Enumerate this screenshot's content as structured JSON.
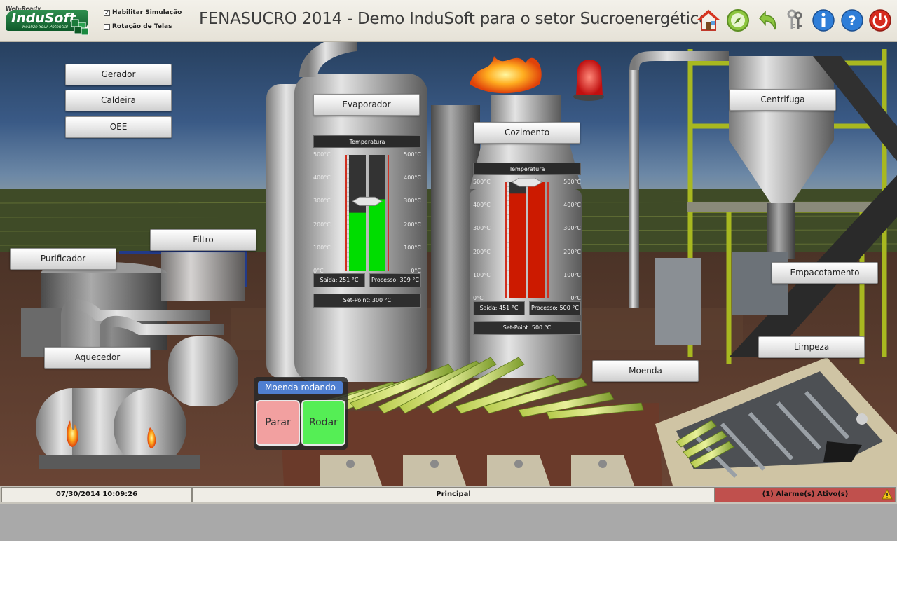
{
  "header": {
    "logo": {
      "small_text": "Web-Ready",
      "main_text": "InduSoft",
      "tagline": "Realize Your Potential"
    },
    "checkboxes": [
      {
        "label": "Habilitar Simulação",
        "checked": true
      },
      {
        "label": "Rotação de Telas",
        "checked": false
      }
    ],
    "title": "FENASUCRO 2014 - Demo InduSoft para o setor Sucroenergético",
    "toolbar_icons": [
      "home-icon",
      "navigation-icon",
      "back-icon",
      "keys-icon",
      "info-icon",
      "help-icon",
      "power-icon"
    ]
  },
  "nav_buttons": {
    "gerador": "Gerador",
    "caldeira": "Caldeira",
    "oee": "OEE",
    "evaporador": "Evaporador",
    "cozimento": "Cozimento",
    "centrifuga": "Centrifuga",
    "filtro": "Filtro",
    "purificador": "Purificador",
    "empacotamento": "Empacotamento",
    "aquecedor": "Aquecedor",
    "limpeza": "Limpeza",
    "moenda": "Moenda"
  },
  "gauges": {
    "evaporador": {
      "title": "Temperatura",
      "scale_labels": [
        "500°C",
        "400°C",
        "300°C",
        "200°C",
        "100°C",
        "0°C"
      ],
      "saida": "Saída: 251 °C",
      "processo": "Processo: 309 °C",
      "setpoint": "Set-Point: 300 °C",
      "saida_value": 251,
      "processo_value": 309,
      "setpoint_value": 300,
      "max": 500,
      "bar_color": "#00dd00"
    },
    "cozimento": {
      "title": "Temperatura",
      "scale_labels": [
        "500°C",
        "400°C",
        "300°C",
        "200°C",
        "100°C",
        "0°C"
      ],
      "saida": "Saída: 451 °C",
      "processo": "Processo: 500 °C",
      "setpoint": "Set-Point: 500 °C",
      "saida_value": 451,
      "processo_value": 500,
      "setpoint_value": 500,
      "max": 500,
      "bar_color": "#cc1a00"
    }
  },
  "moenda_control": {
    "status": "Moenda rodando",
    "stop_label": "Parar",
    "run_label": "Rodar",
    "stop_color": "#f2a0a0",
    "run_color": "#55ee55"
  },
  "statusbar": {
    "datetime": "07/30/2014 10:09:26",
    "screen": "Principal",
    "alarms": "(1) Alarme(s) Ativo(s)",
    "alarm_color": "#c0504d"
  }
}
